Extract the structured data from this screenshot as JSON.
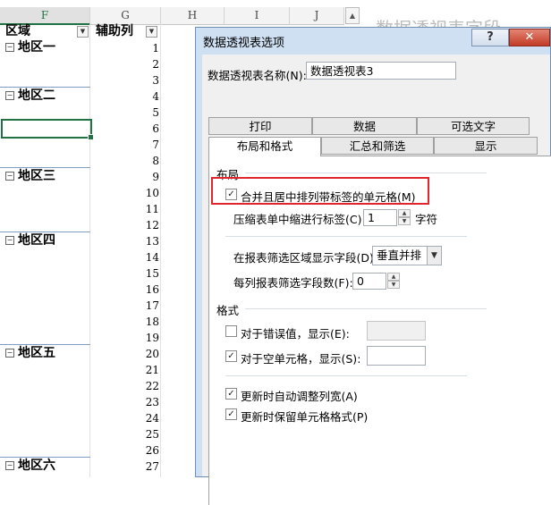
{
  "sheet": {
    "columns": [
      "F",
      "G",
      "H",
      "I",
      "J"
    ],
    "header_region": "区域",
    "header_helper": "辅助列",
    "dropdown_glyph": "▼",
    "row_numbers": [
      "1",
      "2",
      "3",
      "4",
      "5",
      "6",
      "7",
      "8",
      "9",
      "10",
      "11",
      "12",
      "13",
      "14",
      "15",
      "16",
      "17",
      "18",
      "19",
      "20",
      "21",
      "22",
      "23",
      "24",
      "25",
      "26",
      "27"
    ],
    "regions": [
      {
        "label": "地区一",
        "toggle": "−"
      },
      {
        "label": "地区二",
        "toggle": "−"
      },
      {
        "label": "地区三",
        "toggle": "−"
      },
      {
        "label": "地区四",
        "toggle": "−"
      },
      {
        "label": "地区五",
        "toggle": "−"
      },
      {
        "label": "地区六",
        "toggle": "−"
      }
    ],
    "background_title": "数据透视表字段",
    "scroll_up_glyph": "▲",
    "accent_color": "#217346"
  },
  "dialog": {
    "title": "数据透视表选项",
    "help_label": "?",
    "close_label": "✕",
    "name_label": "数据透视表名称(N):",
    "name_value": "数据透视表3",
    "tabs_row1": [
      "打印",
      "数据",
      "可选文字"
    ],
    "tabs_row2": [
      "布局和格式",
      "汇总和筛选",
      "显示"
    ],
    "active_tab": "布局和格式",
    "layout_section": "布局",
    "merge_center_label": "合并且居中排列带标签的单元格(M)",
    "merge_center_checked": true,
    "indent_label": "压缩表单中缩进行标签(C):",
    "indent_value": "1",
    "indent_unit": "字符",
    "filter_area_label": "在报表筛选区域显示字段(D):",
    "filter_area_value": "垂直并排",
    "filter_fields_label": "每列报表筛选字段数(F):",
    "filter_fields_value": "0",
    "format_section": "格式",
    "error_value_label": "对于错误值，显示(E):",
    "error_value_checked": false,
    "empty_cell_label": "对于空单元格，显示(S):",
    "empty_cell_checked": true,
    "autofit_label": "更新时自动调整列宽(A)",
    "autofit_checked": true,
    "preserve_format_label": "更新时保留单元格格式(P)",
    "preserve_format_checked": true,
    "check_glyph": "✓",
    "spin_up": "▲",
    "spin_down": "▼",
    "combo_arrow": "▼",
    "highlight_color": "#e0262c"
  }
}
